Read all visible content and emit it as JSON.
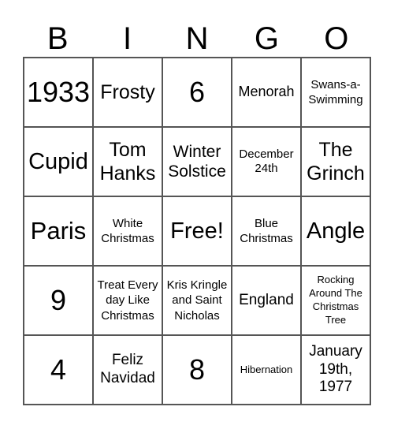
{
  "header": [
    "B",
    "I",
    "N",
    "G",
    "O"
  ],
  "cells": [
    [
      "1933",
      "Frosty",
      "6",
      "Menorah",
      "Swans-a-Swimming"
    ],
    [
      "Cupid",
      "Tom Hanks",
      "Winter Solstice",
      "December 24th",
      "The Grinch"
    ],
    [
      "Paris",
      "White Christmas",
      "Free!",
      "Blue Christmas",
      "Angle"
    ],
    [
      "9",
      "Treat Every day Like Christmas",
      "Kris Kringle and Saint Nicholas",
      "England",
      "Rocking Around The Christmas Tree"
    ],
    [
      "4",
      "Feliz Navidad",
      "8",
      "Hibernation",
      "January 19th, 1977"
    ]
  ]
}
